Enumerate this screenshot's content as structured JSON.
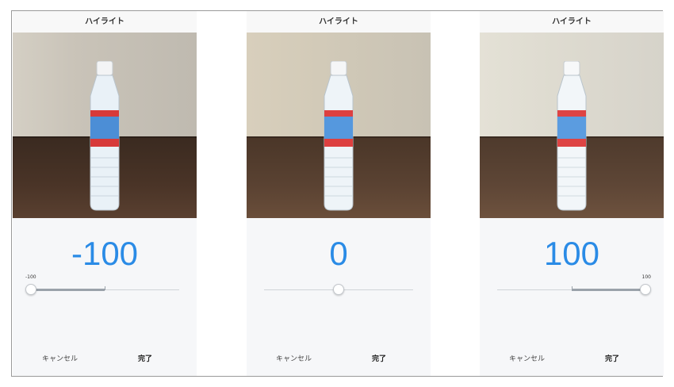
{
  "panels": [
    {
      "title": "ハイライト",
      "value": "-100",
      "slider_label": "-100",
      "slider_fraction": 0.0,
      "cancel_label": "キャンセル",
      "done_label": "完了",
      "tone": "dark"
    },
    {
      "title": "ハイライト",
      "value": "0",
      "slider_label": "",
      "slider_fraction": 0.5,
      "cancel_label": "キャンセル",
      "done_label": "完了",
      "tone": "neutral"
    },
    {
      "title": "ハイライト",
      "value": "100",
      "slider_label": "100",
      "slider_fraction": 1.0,
      "cancel_label": "キャンセル",
      "done_label": "完了",
      "tone": "bright"
    }
  ],
  "colors": {
    "accent": "#2a8be6",
    "panel_bg": "#f6f7f9",
    "table_wood": "#4a3427"
  }
}
